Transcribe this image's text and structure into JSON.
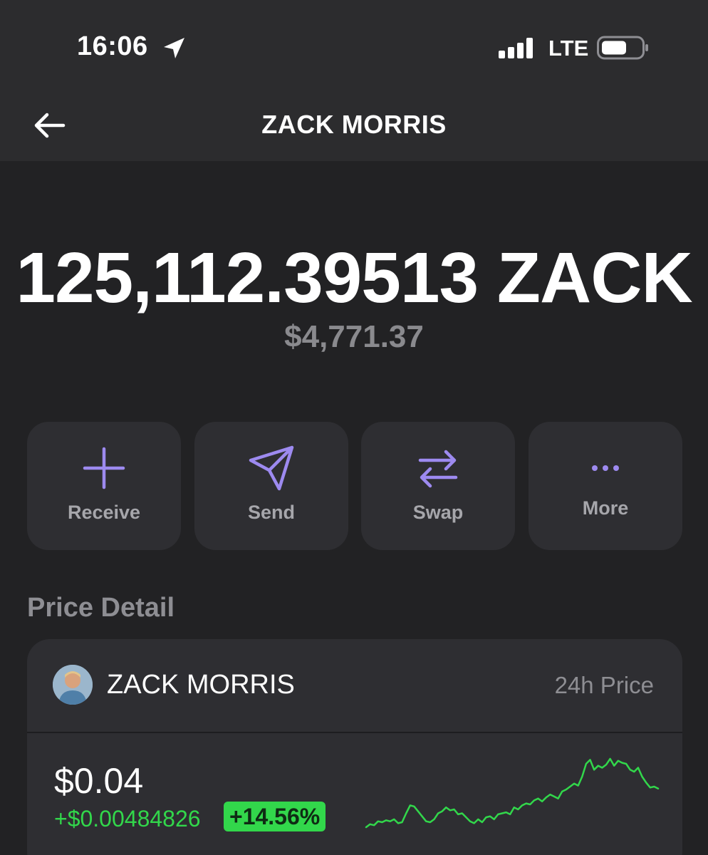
{
  "status_bar": {
    "time": "16:06",
    "network": "LTE",
    "location_icon": "location-arrow-icon",
    "signal_icon": "signal-bars-icon",
    "battery_icon": "battery-icon"
  },
  "nav": {
    "back_icon": "arrow-left-icon",
    "title": "ZACK MORRIS"
  },
  "balance": {
    "amount": "125,112.39513 ZACK",
    "fiat": "$4,771.37"
  },
  "actions": [
    {
      "label": "Receive",
      "icon": "plus-icon"
    },
    {
      "label": "Send",
      "icon": "paper-plane-icon"
    },
    {
      "label": "Swap",
      "icon": "swap-arrows-icon"
    },
    {
      "label": "More",
      "icon": "more-dots-icon"
    }
  ],
  "price_detail": {
    "section_title": "Price Detail",
    "token_name": "ZACK MORRIS",
    "period_label": "24h Price",
    "price": "$0.04",
    "change_abs": "+$0.00484826",
    "change_pct": "+14.56%",
    "sparkline": [
      4,
      7,
      6,
      10,
      9,
      11,
      10,
      12,
      8,
      9,
      18,
      26,
      25,
      20,
      15,
      10,
      9,
      12,
      18,
      20,
      24,
      21,
      22,
      17,
      18,
      14,
      10,
      8,
      12,
      9,
      14,
      15,
      12,
      17,
      18,
      19,
      17,
      24,
      22,
      26,
      28,
      27,
      31,
      33,
      30,
      34,
      37,
      35,
      33,
      40,
      42,
      45,
      48,
      46,
      55,
      68,
      72,
      62,
      66,
      64,
      67,
      73,
      66,
      71,
      69,
      68,
      62,
      60,
      64,
      55,
      49,
      44,
      45,
      43
    ]
  },
  "colors": {
    "background": "#222224",
    "header": "#2c2c2e",
    "card": "#2e2e32",
    "accent_purple": "#9d8af0",
    "positive_green": "#32d74b",
    "muted_text": "#8e8e93"
  }
}
